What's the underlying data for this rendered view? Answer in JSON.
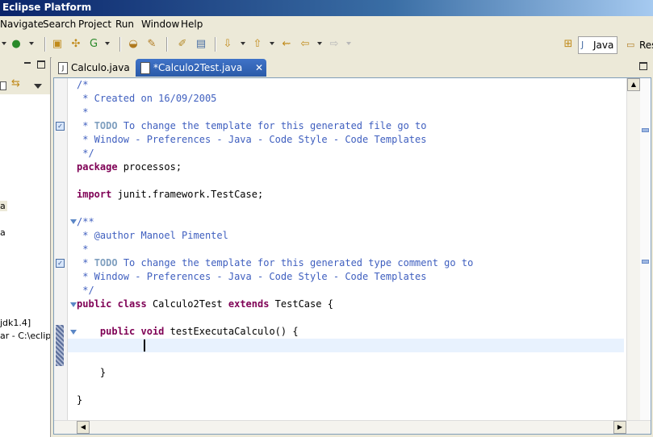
{
  "window": {
    "title": "Eclipse Platform"
  },
  "menu": [
    "Navigate",
    "Search",
    "Project",
    "Run",
    "Window",
    "Help"
  ],
  "perspectives": [
    "Java",
    "Res"
  ],
  "left_panel": {
    "items": [
      "a",
      "a",
      "jdk1.4]",
      "ar - C:\\eclips"
    ]
  },
  "tabs": [
    {
      "label": "Calculo.java",
      "active": false
    },
    {
      "label": "*Calculo2Test.java",
      "active": true
    }
  ],
  "editor": {
    "lines": [
      {
        "parts": [
          {
            "t": "/*",
            "c": "cm"
          }
        ]
      },
      {
        "parts": [
          {
            "t": " * Created on 16/09/2005",
            "c": "cm"
          }
        ]
      },
      {
        "parts": [
          {
            "t": " *",
            "c": "cm"
          }
        ]
      },
      {
        "parts": [
          {
            "t": " * ",
            "c": "cm"
          },
          {
            "t": "TODO",
            "c": "tk"
          },
          {
            "t": " To change the template for this generated file go to",
            "c": "cm"
          }
        ]
      },
      {
        "parts": [
          {
            "t": " * Window - Preferences - Java - Code Style - Code Templates",
            "c": "cm"
          }
        ]
      },
      {
        "parts": [
          {
            "t": " */",
            "c": "cm"
          }
        ]
      },
      {
        "parts": [
          {
            "t": "package",
            "c": "kw"
          },
          {
            "t": " processos;",
            "c": ""
          }
        ]
      },
      {
        "parts": []
      },
      {
        "parts": [
          {
            "t": "import",
            "c": "kw"
          },
          {
            "t": " junit.framework.TestCase;",
            "c": ""
          }
        ]
      },
      {
        "parts": []
      },
      {
        "parts": [
          {
            "t": "/**",
            "c": "cm"
          }
        ]
      },
      {
        "parts": [
          {
            "t": " * @author Manoel Pimentel",
            "c": "cm"
          }
        ]
      },
      {
        "parts": [
          {
            "t": " *",
            "c": "cm"
          }
        ]
      },
      {
        "parts": [
          {
            "t": " * ",
            "c": "cm"
          },
          {
            "t": "TODO",
            "c": "tk"
          },
          {
            "t": " To change the template for this generated type comment go to",
            "c": "cm"
          }
        ]
      },
      {
        "parts": [
          {
            "t": " * Window - Preferences - Java - Code Style - Code Templates",
            "c": "cm"
          }
        ]
      },
      {
        "parts": [
          {
            "t": " */",
            "c": "cm"
          }
        ]
      },
      {
        "parts": [
          {
            "t": "public",
            "c": "kw"
          },
          {
            "t": " ",
            "c": ""
          },
          {
            "t": "class",
            "c": "kw"
          },
          {
            "t": " Calculo2Test ",
            "c": ""
          },
          {
            "t": "extends",
            "c": "kw"
          },
          {
            "t": " TestCase {",
            "c": ""
          }
        ]
      },
      {
        "parts": []
      },
      {
        "parts": [
          {
            "t": "    ",
            "c": ""
          },
          {
            "t": "public",
            "c": "kw"
          },
          {
            "t": " ",
            "c": ""
          },
          {
            "t": "void",
            "c": "kw"
          },
          {
            "t": " testExecutaCalculo() {",
            "c": ""
          }
        ]
      },
      {
        "parts": []
      },
      {
        "parts": []
      },
      {
        "parts": [
          {
            "t": "    }",
            "c": ""
          }
        ]
      },
      {
        "parts": []
      },
      {
        "parts": [
          {
            "t": "}",
            "c": ""
          }
        ]
      }
    ]
  },
  "colors": {
    "keyword": "#7f0055",
    "comment": "#3f5fbf",
    "todo": "#7f9fbf",
    "current_line": "#e8f2fe"
  }
}
